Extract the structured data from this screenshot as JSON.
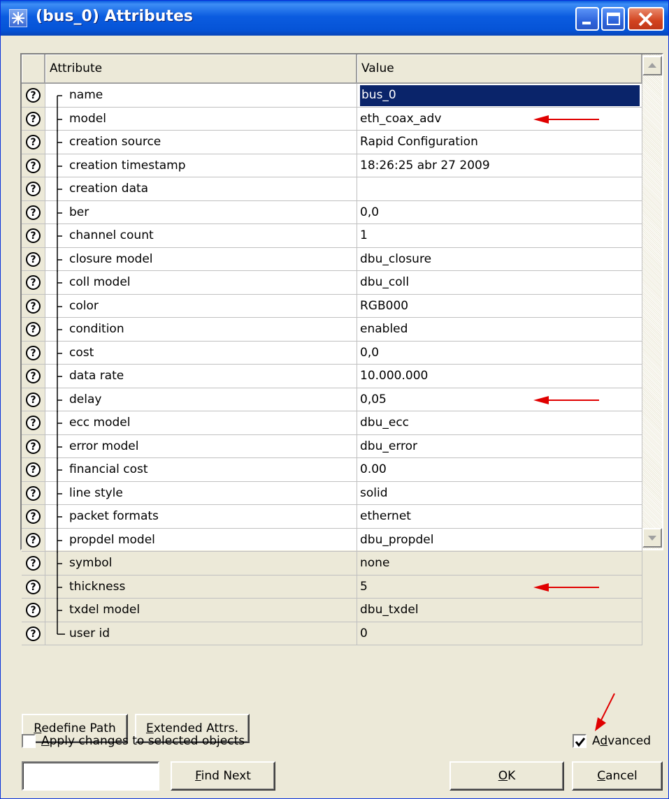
{
  "window": {
    "title": "(bus_0) Attributes",
    "icon": "star-burst-icon"
  },
  "grid": {
    "columns": {
      "attribute": "Attribute",
      "value": "Value"
    },
    "rows": [
      {
        "name": "name",
        "value": "bus_0",
        "selected": true
      },
      {
        "name": "model",
        "value": "eth_coax_adv",
        "arrow": true
      },
      {
        "name": "creation source",
        "value": "Rapid Configuration"
      },
      {
        "name": "creation timestamp",
        "value": "18:26:25 abr 27 2009"
      },
      {
        "name": "creation data",
        "value": ""
      },
      {
        "name": "ber",
        "value": "0,0"
      },
      {
        "name": "channel count",
        "value": "1"
      },
      {
        "name": "closure model",
        "value": "dbu_closure"
      },
      {
        "name": "coll model",
        "value": "dbu_coll"
      },
      {
        "name": "color",
        "value": "RGB000"
      },
      {
        "name": "condition",
        "value": "enabled"
      },
      {
        "name": "cost",
        "value": "0,0"
      },
      {
        "name": "data rate",
        "value": "10.000.000"
      },
      {
        "name": "delay",
        "value": "0,05",
        "arrow": true
      },
      {
        "name": "ecc model",
        "value": "dbu_ecc"
      },
      {
        "name": "error model",
        "value": "dbu_error"
      },
      {
        "name": "financial cost",
        "value": "0.00"
      },
      {
        "name": "line style",
        "value": "solid"
      },
      {
        "name": "packet formats",
        "value": "ethernet"
      },
      {
        "name": "propdel model",
        "value": "dbu_propdel"
      },
      {
        "name": "symbol",
        "value": "none"
      },
      {
        "name": "thickness",
        "value": "5",
        "arrow": true
      },
      {
        "name": "txdel model",
        "value": "dbu_txdel"
      },
      {
        "name": "user id",
        "value": "0"
      }
    ]
  },
  "buttons": {
    "redefine_path": {
      "mn": "R",
      "rest": "edefine Path"
    },
    "extended_attrs": {
      "mn": "E",
      "rest": "xtended Attrs."
    },
    "find_next": {
      "mn": "F",
      "rest": "ind Next"
    },
    "ok": {
      "mn": "O",
      "rest": "K"
    },
    "cancel": {
      "mn": "C",
      "rest": "ancel"
    }
  },
  "checks": {
    "apply": {
      "mn": "A",
      "rest": "pply changes to selected objects",
      "checked": false
    },
    "advanced": {
      "pre": "A",
      "mn": "d",
      "rest": "vanced",
      "checked": true
    }
  },
  "find": {
    "value": ""
  },
  "annotation_color": "#e00000"
}
